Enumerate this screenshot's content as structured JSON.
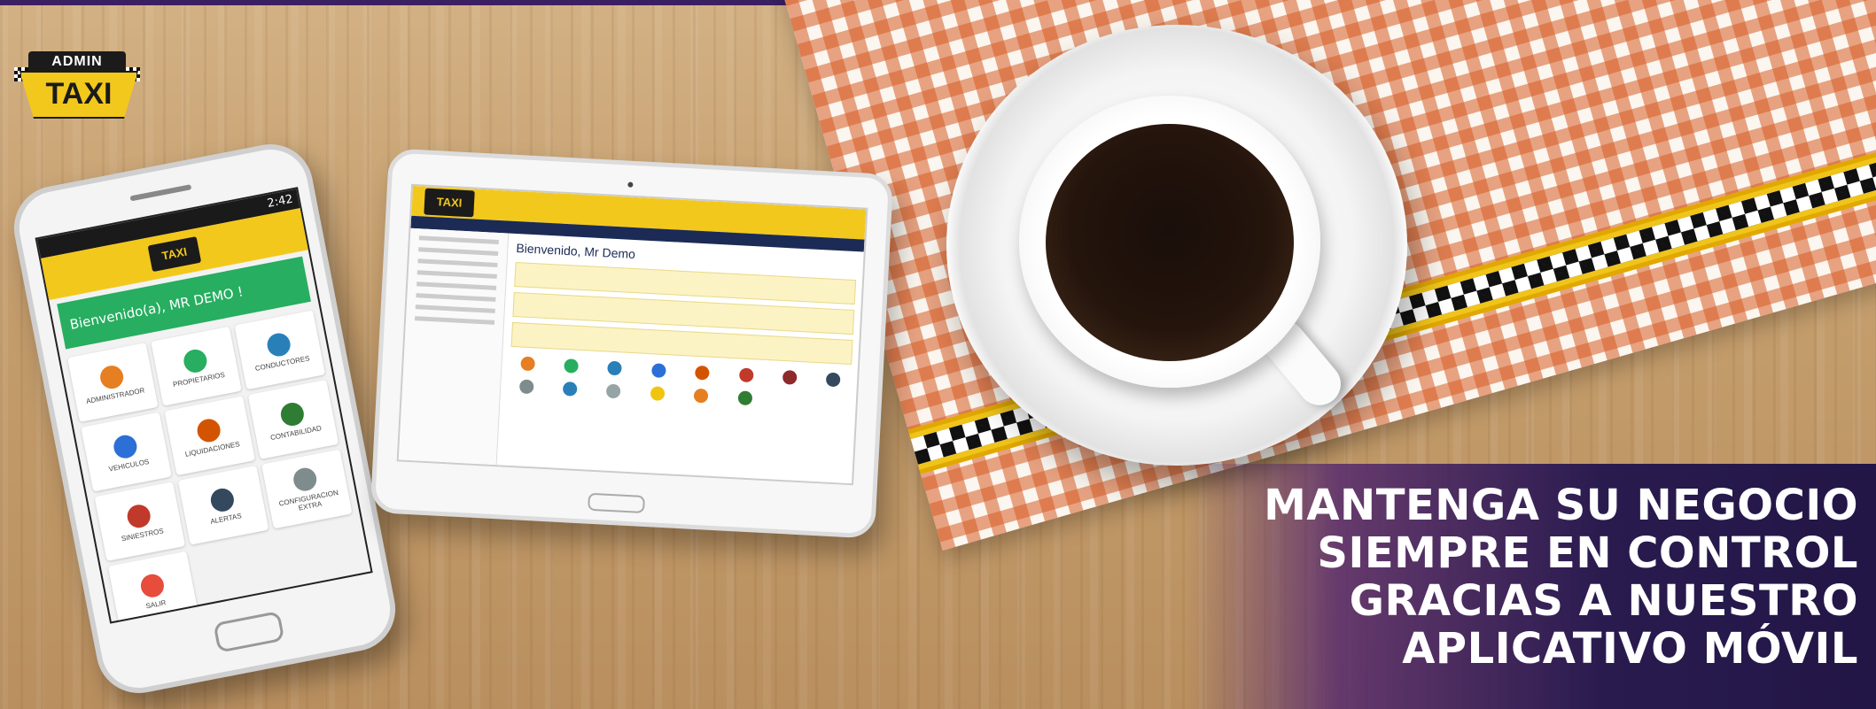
{
  "logo": {
    "top": "ADMIN",
    "bottom": "TAXI"
  },
  "phone": {
    "status_time": "2:42",
    "header_logo": "TAXI",
    "welcome": "Bienvenido(a), MR DEMO !",
    "tiles": [
      {
        "label": "ADMINISTRADOR",
        "icon": "house-icon",
        "color": "#e67e22"
      },
      {
        "label": "PROPIETARIOS",
        "icon": "car-icon",
        "color": "#27ae60"
      },
      {
        "label": "CONDUCTORES",
        "icon": "pin-icon",
        "color": "#2980b9"
      },
      {
        "label": "VEHICULOS",
        "icon": "bus-icon",
        "color": "#2c6fd6"
      },
      {
        "label": "LIQUIDACIONES",
        "icon": "calc-icon",
        "color": "#d35400"
      },
      {
        "label": "CONTABILIDAD",
        "icon": "ledger-icon",
        "color": "#2e7d32"
      },
      {
        "label": "SINIESTROS",
        "icon": "warning-icon",
        "color": "#c0392b"
      },
      {
        "label": "ALERTAS",
        "icon": "bell-icon",
        "color": "#34495e"
      },
      {
        "label": "CONFIGURACION EXTRA",
        "icon": "wrench-icon",
        "color": "#7f8c8d"
      },
      {
        "label": "SALIR",
        "icon": "power-icon",
        "color": "#e74c3c"
      }
    ]
  },
  "tablet": {
    "header_logo": "TAXI",
    "title": "Bienvenido, Mr Demo"
  },
  "headline": {
    "line1": "MANTENGA SU NEGOCIO",
    "line2": "SIEMPRE EN CONTROL",
    "line3": "GRACIAS A NUESTRO",
    "line4": "APLICATIVO MÓVIL"
  }
}
